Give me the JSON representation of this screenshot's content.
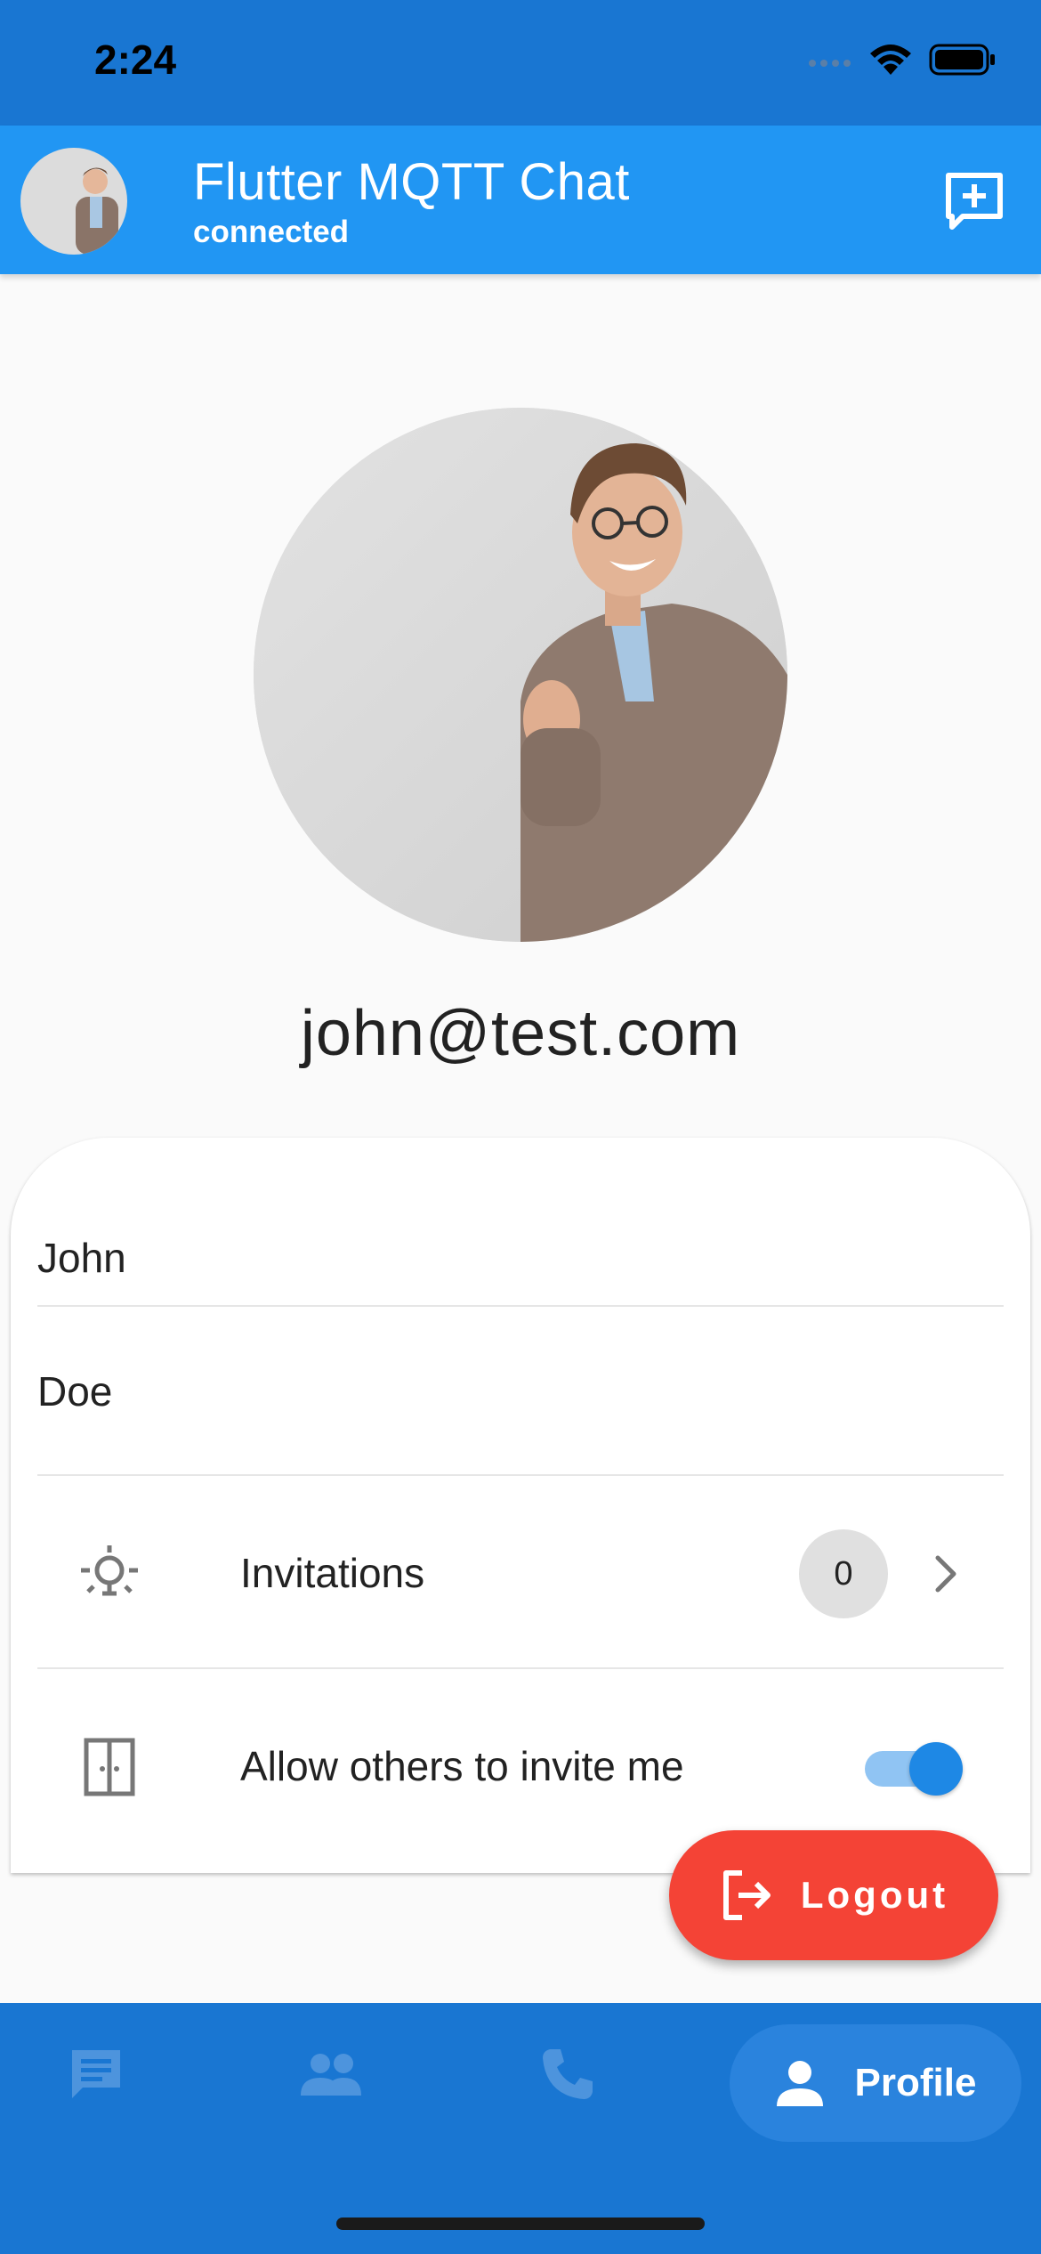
{
  "status_bar": {
    "time": "2:24"
  },
  "app_bar": {
    "title": "Flutter MQTT Chat",
    "subtitle": "connected",
    "new_chat_icon": "add-chat-icon"
  },
  "profile": {
    "email": "john@test.com",
    "first_name": "John",
    "last_name": "Doe"
  },
  "settings": {
    "invitations": {
      "label": "Invitations",
      "count": "0",
      "icon": "lightbulb-icon"
    },
    "allow_invites": {
      "label": "Allow others to invite me",
      "enabled": true,
      "icon": "door-icon"
    }
  },
  "logout": {
    "label": "Logout",
    "icon": "logout-icon"
  },
  "bottom_nav": {
    "items": [
      {
        "icon": "chat-icon",
        "label": ""
      },
      {
        "icon": "people-icon",
        "label": ""
      },
      {
        "icon": "phone-icon",
        "label": ""
      },
      {
        "icon": "person-icon",
        "label": "Profile",
        "selected": true
      }
    ]
  },
  "colors": {
    "primary": "#2196f3",
    "primary_dark": "#1976d2",
    "logout": "#f44336",
    "toggle_active": "#1e88e5"
  }
}
